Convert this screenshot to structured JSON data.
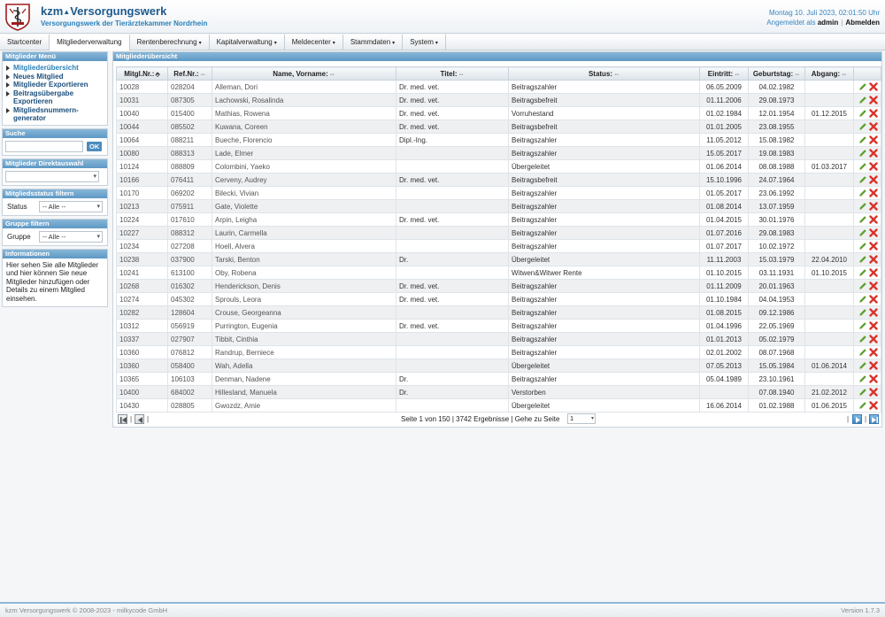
{
  "header": {
    "brand_prefix": "kzm",
    "brand_name": "Versorgungswerk",
    "tagline": "Versorgungswerk der Tierärztekammer Nordrhein",
    "datetime": "Montag 10. Juli 2023, 02:01:50 Uhr",
    "logged_in_prefix": "Angemeldet als",
    "username": "admin",
    "logout_label": "Abmelden"
  },
  "nav": {
    "items": [
      {
        "label": "Startcenter",
        "caret": ""
      },
      {
        "label": "Mitgliederverwaltung",
        "caret": ""
      },
      {
        "label": "Rentenberechnung",
        "caret": "▾"
      },
      {
        "label": "Kapitalverwaltung",
        "caret": "▾"
      },
      {
        "label": "Meldecenter",
        "caret": "▾"
      },
      {
        "label": "Stammdaten",
        "caret": "▾"
      },
      {
        "label": "System",
        "caret": "▾"
      }
    ]
  },
  "sidebar": {
    "menu_title": "Mitglieder Menü",
    "menu_items": [
      {
        "label": "Mitgliederübersicht"
      },
      {
        "label": "Neues Mitglied"
      },
      {
        "label": "Mitglieder Exportieren"
      },
      {
        "label": "Beitragsübergabe Exportieren"
      },
      {
        "label": "Mitgliedsnummern-generator"
      }
    ],
    "search_title": "Suche",
    "search_ok": "OK",
    "direct_title": "Mitglieder Direktauswahl",
    "status_title": "Mitgliedsstatus filtern",
    "status_label": "Status",
    "status_value": "-- Alle --",
    "group_title": "Gruppe filtern",
    "group_label": "Gruppe",
    "group_value": "-- Alle --",
    "info_title": "Informationen",
    "info_text": "Hier sehen Sie alle Mitglieder und hier können Sie neue Mitglieder hinzufügen oder Details zu einem Mitglied einsehen."
  },
  "main": {
    "title": "Mitgliederübersicht",
    "columns": {
      "mitgl_nr": "Mitgl.Nr.:",
      "ref_nr": "Ref.Nr.:",
      "name": "Name, Vorname:",
      "titel": "Titel:",
      "status": "Status:",
      "eintritt": "Eintritt:",
      "geburtstag": "Geburtstag:",
      "abgang": "Abgang:"
    },
    "rows": [
      {
        "nr": "10028",
        "ref": "028204",
        "name": "Alleman, Dori",
        "titel": "Dr. med. vet.",
        "status": "Beitragszahler",
        "eintritt": "06.05.2009",
        "geb": "04.02.1982",
        "abgang": ""
      },
      {
        "nr": "10031",
        "ref": "087305",
        "name": "Lachowski, Rosalinda",
        "titel": "Dr. med. vet.",
        "status": "Beitragsbefreit",
        "eintritt": "01.11.2006",
        "geb": "29.08.1973",
        "abgang": ""
      },
      {
        "nr": "10040",
        "ref": "015400",
        "name": "Mathias, Rowena",
        "titel": "Dr. med. vet.",
        "status": "Vorruhestand",
        "eintritt": "01.02.1984",
        "geb": "12.01.1954",
        "abgang": "01.12.2015"
      },
      {
        "nr": "10044",
        "ref": "085502",
        "name": "Kuwana, Coreen",
        "titel": "Dr. med. vet.",
        "status": "Beitragsbefreit",
        "eintritt": "01.01.2005",
        "geb": "23.08.1955",
        "abgang": ""
      },
      {
        "nr": "10064",
        "ref": "088211",
        "name": "Bueche, Florencio",
        "titel": "Dipl.-Ing.",
        "status": "Beitragszahler",
        "eintritt": "11.05.2012",
        "geb": "15.08.1982",
        "abgang": ""
      },
      {
        "nr": "10080",
        "ref": "088313",
        "name": "Lade, Elmer",
        "titel": "",
        "status": "Beitragszahler",
        "eintritt": "15.05.2017",
        "geb": "19.08.1983",
        "abgang": ""
      },
      {
        "nr": "10124",
        "ref": "088809",
        "name": "Colombini, Yaeko",
        "titel": "",
        "status": "Übergeleitet",
        "eintritt": "01.06.2014",
        "geb": "08.08.1988",
        "abgang": "01.03.2017"
      },
      {
        "nr": "10166",
        "ref": "076411",
        "name": "Cerveny, Audrey",
        "titel": "Dr. med. vet.",
        "status": "Beitragsbefreit",
        "eintritt": "15.10.1996",
        "geb": "24.07.1964",
        "abgang": ""
      },
      {
        "nr": "10170",
        "ref": "069202",
        "name": "Bilecki, Vivian",
        "titel": "",
        "status": "Beitragszahler",
        "eintritt": "01.05.2017",
        "geb": "23.06.1992",
        "abgang": ""
      },
      {
        "nr": "10213",
        "ref": "075911",
        "name": "Gate, Violette",
        "titel": "",
        "status": "Beitragszahler",
        "eintritt": "01.08.2014",
        "geb": "13.07.1959",
        "abgang": ""
      },
      {
        "nr": "10224",
        "ref": "017610",
        "name": "Arpin, Leigha",
        "titel": "Dr. med. vet.",
        "status": "Beitragszahler",
        "eintritt": "01.04.2015",
        "geb": "30.01.1976",
        "abgang": ""
      },
      {
        "nr": "10227",
        "ref": "088312",
        "name": "Laurin, Carmella",
        "titel": "",
        "status": "Beitragszahler",
        "eintritt": "01.07.2016",
        "geb": "29.08.1983",
        "abgang": ""
      },
      {
        "nr": "10234",
        "ref": "027208",
        "name": "Hoell, Alvera",
        "titel": "",
        "status": "Beitragszahler",
        "eintritt": "01.07.2017",
        "geb": "10.02.1972",
        "abgang": ""
      },
      {
        "nr": "10238",
        "ref": "037900",
        "name": "Tarski, Benton",
        "titel": "Dr.",
        "status": "Übergeleitet",
        "eintritt": "11.11.2003",
        "geb": "15.03.1979",
        "abgang": "22.04.2010"
      },
      {
        "nr": "10241",
        "ref": "613100",
        "name": "Oby, Robena",
        "titel": "",
        "status": "Witwen&Witwer Rente",
        "eintritt": "01.10.2015",
        "geb": "03.11.1931",
        "abgang": "01.10.2015"
      },
      {
        "nr": "10268",
        "ref": "016302",
        "name": "Henderickson, Denis",
        "titel": "Dr. med. vet.",
        "status": "Beitragszahler",
        "eintritt": "01.11.2009",
        "geb": "20.01.1963",
        "abgang": ""
      },
      {
        "nr": "10274",
        "ref": "045302",
        "name": "Sprouls, Leora",
        "titel": "Dr. med. vet.",
        "status": "Beitragszahler",
        "eintritt": "01.10.1984",
        "geb": "04.04.1953",
        "abgang": ""
      },
      {
        "nr": "10282",
        "ref": "128604",
        "name": "Crouse, Georgeanna",
        "titel": "",
        "status": "Beitragszahler",
        "eintritt": "01.08.2015",
        "geb": "09.12.1986",
        "abgang": ""
      },
      {
        "nr": "10312",
        "ref": "056919",
        "name": "Purrington, Eugenia",
        "titel": "Dr. med. vet.",
        "status": "Beitragszahler",
        "eintritt": "01.04.1996",
        "geb": "22.05.1969",
        "abgang": ""
      },
      {
        "nr": "10337",
        "ref": "027907",
        "name": "Tibbit, Cinthia",
        "titel": "",
        "status": "Beitragszahler",
        "eintritt": "01.01.2013",
        "geb": "05.02.1979",
        "abgang": ""
      },
      {
        "nr": "10360",
        "ref": "076812",
        "name": "Randrup, Berniece",
        "titel": "",
        "status": "Beitragszahler",
        "eintritt": "02.01.2002",
        "geb": "08.07.1968",
        "abgang": ""
      },
      {
        "nr": "10360",
        "ref": "058400",
        "name": "Wah, Adella",
        "titel": "",
        "status": "Übergeleitet",
        "eintritt": "07.05.2013",
        "geb": "15.05.1984",
        "abgang": "01.06.2014"
      },
      {
        "nr": "10365",
        "ref": "106103",
        "name": "Denman, Nadene",
        "titel": "Dr.",
        "status": "Beitragszahler",
        "eintritt": "05.04.1989",
        "geb": "23.10.1961",
        "abgang": ""
      },
      {
        "nr": "10400",
        "ref": "684002",
        "name": "Hillesland, Manuela",
        "titel": "Dr.",
        "status": "Verstorben",
        "eintritt": "",
        "geb": "07.08.1940",
        "abgang": "21.02.2012"
      },
      {
        "nr": "10430",
        "ref": "028805",
        "name": "Gwozdz, Amie",
        "titel": "",
        "status": "Übergeleitet",
        "eintritt": "16.06.2014",
        "geb": "01.02.1988",
        "abgang": "01.06.2015"
      }
    ],
    "pager": {
      "info": "Seite 1 von 150 | 3742 Ergebnisse | Gehe zu Seite",
      "page_value": "1"
    }
  },
  "footer": {
    "copyright": "kzm Versorgungswerk © 2008-2023 - milkycode GmbH",
    "version": "Version 1.7.3"
  },
  "colors": {
    "brand": "#1e5a8c",
    "panel_header": "#5e98c4",
    "edit": "#5aa02c",
    "delete": "#d9342b"
  }
}
